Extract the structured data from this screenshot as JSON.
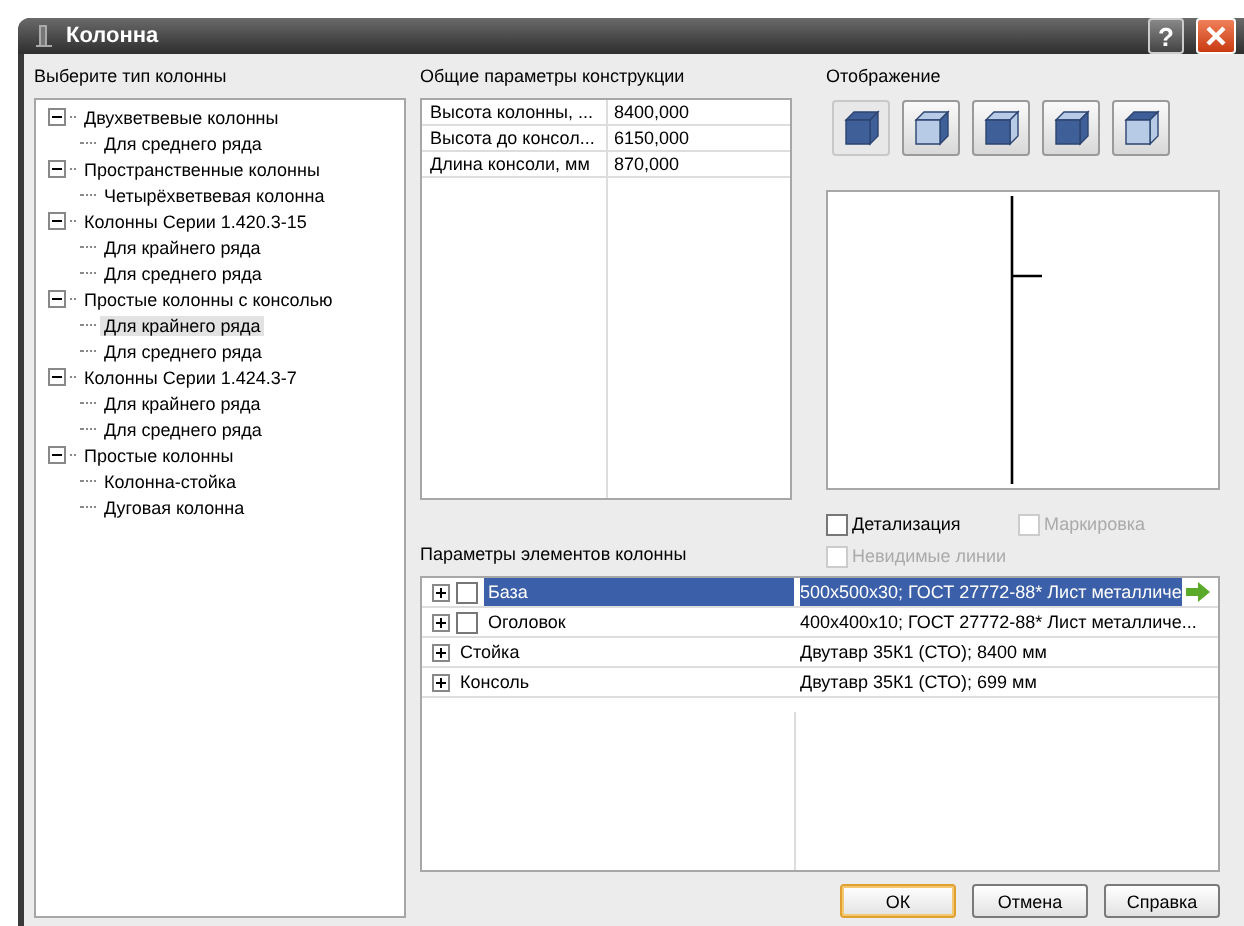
{
  "window": {
    "title": "Колонна",
    "help_button": "?"
  },
  "column_type": {
    "label": "Выберите тип колонны",
    "tree": [
      {
        "label": "Двухветвевые колонны",
        "expanded": true,
        "selected": false,
        "children": [
          {
            "label": "Для среднего ряда",
            "selected": false
          }
        ]
      },
      {
        "label": "Пространственные колонны",
        "expanded": true,
        "selected": false,
        "children": [
          {
            "label": "Четырёхветвевая колонна",
            "selected": false
          }
        ]
      },
      {
        "label": "Колонны Серии 1.420.3-15",
        "expanded": true,
        "selected": false,
        "children": [
          {
            "label": "Для крайнего ряда",
            "selected": false
          },
          {
            "label": "Для среднего ряда",
            "selected": false
          }
        ]
      },
      {
        "label": "Простые колонны с консолью",
        "expanded": true,
        "selected": false,
        "children": [
          {
            "label": "Для крайнего ряда",
            "selected": true
          },
          {
            "label": "Для среднего ряда",
            "selected": false
          }
        ]
      },
      {
        "label": "Колонны Серии 1.424.3-7",
        "expanded": true,
        "selected": false,
        "children": [
          {
            "label": "Для крайнего ряда",
            "selected": false
          },
          {
            "label": "Для среднего ряда",
            "selected": false
          }
        ]
      },
      {
        "label": "Простые колонны",
        "expanded": true,
        "selected": false,
        "children": [
          {
            "label": "Колонна-стойка",
            "selected": false
          },
          {
            "label": "Дуговая колонна",
            "selected": false
          }
        ]
      }
    ]
  },
  "general_params": {
    "label": "Общие параметры конструкции",
    "rows": [
      {
        "name": "Высота колонны, ...",
        "value": "8400,000"
      },
      {
        "name": "Высота до консол...",
        "value": "6150,000"
      },
      {
        "name": "Длина консоли, мм",
        "value": "870,000"
      }
    ]
  },
  "display": {
    "label": "Отображение",
    "views": [
      {
        "selected": true
      },
      {
        "selected": false
      },
      {
        "selected": false
      },
      {
        "selected": false
      },
      {
        "selected": false
      }
    ],
    "options": [
      {
        "label": "Детализация",
        "checked": false,
        "disabled": false
      },
      {
        "label": "Маркировка",
        "checked": false,
        "disabled": true
      },
      {
        "label": "Невидимые линии",
        "checked": false,
        "disabled": true
      }
    ]
  },
  "elements": {
    "label": "Параметры элементов колонны",
    "rows": [
      {
        "kind": "checkbox",
        "checked": false,
        "name": "База",
        "value": "500x500x30; ГОСТ 27772-88* Лист металличе",
        "selected": true
      },
      {
        "kind": "checkbox",
        "checked": false,
        "name": "Оголовок",
        "value": "400x400x10; ГОСТ 27772-88* Лист металличе...",
        "selected": false
      },
      {
        "kind": "plain",
        "name": "Стойка",
        "value": "Двутавр 35К1 (СТО); 8400 мм",
        "selected": false
      },
      {
        "kind": "plain",
        "name": "Консоль",
        "value": "Двутавр 35К1 (СТО); 699 мм",
        "selected": false
      }
    ]
  },
  "buttons": [
    {
      "label": "ОК",
      "default": true
    },
    {
      "label": "Отмена",
      "default": false
    },
    {
      "label": "Справка",
      "default": false
    }
  ]
}
